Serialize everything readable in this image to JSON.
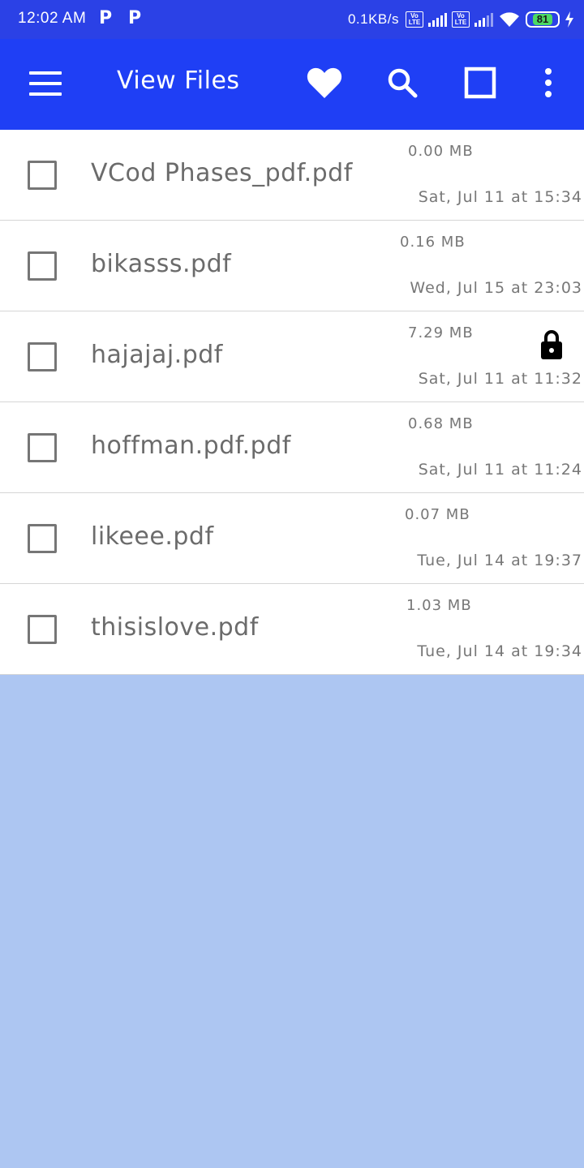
{
  "status_bar": {
    "time": "12:02 AM",
    "notification_icons": [
      "P",
      "P"
    ],
    "net_speed": "0.1KB/s",
    "lte_label_1": "Vo LTE",
    "lte_label_2": "Vo LTE",
    "battery_level": "81",
    "colors": {
      "background": "#2b41e6",
      "battery": "#4cd964"
    }
  },
  "app_bar": {
    "title": "View Files",
    "icons": [
      "menu-icon",
      "heart-icon",
      "search-icon",
      "select-all-icon",
      "more-vert-icon"
    ],
    "color": "#1f3ff5"
  },
  "files": [
    {
      "name": "VCod Phases_pdf.pdf",
      "size": "0.00 MB",
      "date": "Sat, Jul 11 at 15:34",
      "locked": false
    },
    {
      "name": "bikasss.pdf",
      "size": "0.16 MB",
      "date": "Wed, Jul 15 at 23:03",
      "locked": false
    },
    {
      "name": "hajajaj.pdf",
      "size": "7.29 MB",
      "date": "Sat, Jul 11 at 11:32",
      "locked": true
    },
    {
      "name": "hoffman.pdf.pdf",
      "size": "0.68 MB",
      "date": "Sat, Jul 11 at 11:24",
      "locked": false
    },
    {
      "name": "likeee.pdf",
      "size": "0.07 MB",
      "date": "Tue, Jul 14 at 19:37",
      "locked": false
    },
    {
      "name": "thisislove.pdf",
      "size": "1.03 MB",
      "date": "Tue, Jul 14 at 19:34",
      "locked": false
    }
  ],
  "colors": {
    "page_background": "#adc6f2",
    "text_gray": "#6b6b6b"
  }
}
